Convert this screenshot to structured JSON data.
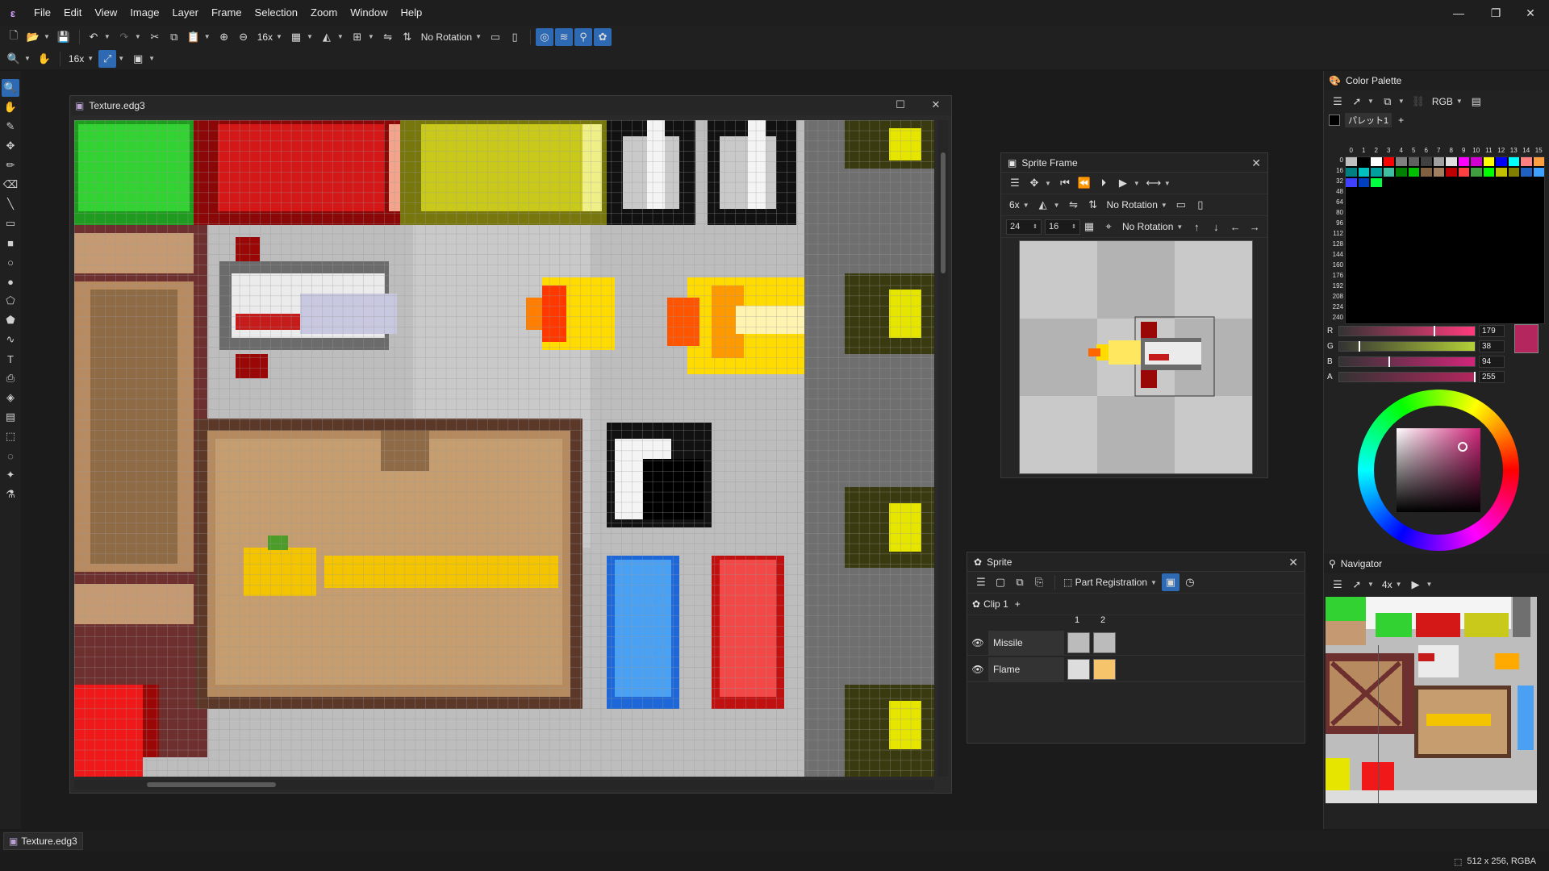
{
  "app": {
    "icon": "edge-app-icon"
  },
  "menu": [
    "File",
    "Edit",
    "View",
    "Image",
    "Layer",
    "Frame",
    "Selection",
    "Zoom",
    "Window",
    "Help"
  ],
  "toolbar1": {
    "zoom": "16x",
    "rotation": "No Rotation"
  },
  "toolbar2": {
    "zoom": "16x"
  },
  "document": {
    "title": "Texture.edg3"
  },
  "sprite_frame": {
    "title": "Sprite Frame",
    "zoom": "6x",
    "rotation1": "No Rotation",
    "rotation2": "No Rotation",
    "x": "24",
    "y": "16"
  },
  "sprite": {
    "title": "Sprite",
    "registration": "Part Registration",
    "clip": "Clip 1",
    "frames": [
      "1",
      "2"
    ],
    "parts": [
      "Missile",
      "Flame"
    ]
  },
  "color_palette": {
    "title": "Color Palette",
    "mode": "RGB",
    "palette_name": "パレット1",
    "col_headers": [
      "0",
      "1",
      "2",
      "3",
      "4",
      "5",
      "6",
      "7",
      "8",
      "9",
      "10",
      "11",
      "12",
      "13",
      "14",
      "15"
    ],
    "row_headers": [
      "0",
      "16",
      "32",
      "48",
      "64",
      "80",
      "96",
      "112",
      "128",
      "144",
      "160",
      "176",
      "192",
      "208",
      "224",
      "240"
    ],
    "palette_colors": [
      "#c0c0c0",
      "#000000",
      "#ffffff",
      "#ff0000",
      "#808080",
      "#606060",
      "#404040",
      "#a0a0a0",
      "#e0e0e0",
      "#ff00ff",
      "#d000d0",
      "#ffff00",
      "#0000ff",
      "#00ffff",
      "#ff8080",
      "#ffa040",
      "#008080",
      "#00c0c0",
      "#00a0a0",
      "#40c0a0",
      "#008000",
      "#00c000",
      "#806040",
      "#a08060",
      "#c00000",
      "#ff4040",
      "#40a040",
      "#00ff00",
      "#c0c000",
      "#808000",
      "#2060c0",
      "#40a0ff",
      "#4040ff",
      "#0040c0",
      "#00ff40"
    ],
    "channels": [
      {
        "label": "R",
        "value": "179",
        "color": "#ff3b7d"
      },
      {
        "label": "G",
        "value": "38",
        "color": "#b3d038"
      },
      {
        "label": "B",
        "value": "94",
        "color": "#d0267a"
      },
      {
        "label": "A",
        "value": "255",
        "color": "#b3265e"
      }
    ],
    "current_color": "#b3265e"
  },
  "navigator": {
    "title": "Navigator",
    "zoom": "4x"
  },
  "taskbar": {
    "doc_tab": "Texture.edg3"
  },
  "status": {
    "image_info": "512 x 256, RGBA"
  }
}
